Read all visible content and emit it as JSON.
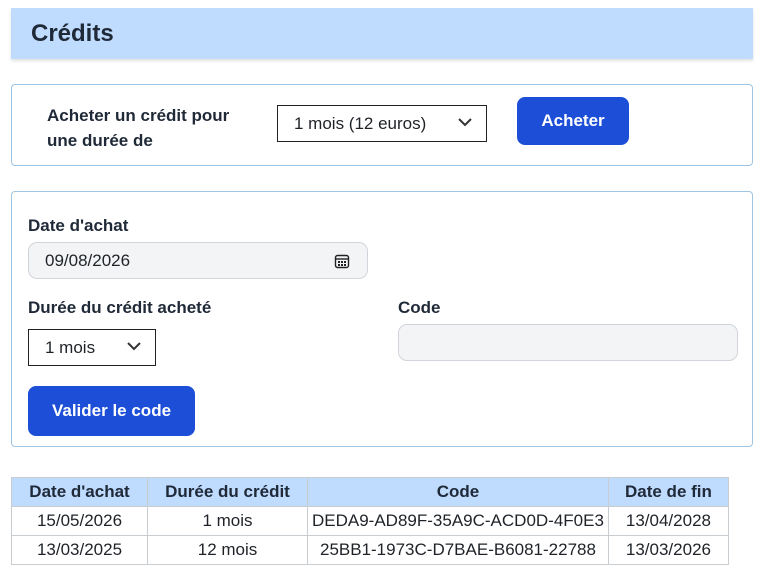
{
  "header": {
    "title": "Crédits"
  },
  "buy": {
    "label": "Acheter un crédit pour une durée de",
    "selected_option": "1 mois (12 euros)",
    "button_label": "Acheter"
  },
  "code_form": {
    "date_label": "Date d'achat",
    "date_value": "09/08/2026",
    "duration_label": "Durée du crédit acheté",
    "duration_value": "1 mois",
    "code_label": "Code",
    "code_value": "",
    "validate_label": "Valider le code"
  },
  "table": {
    "headers": [
      "Date d'achat",
      "Durée du crédit",
      "Code",
      "Date de fin"
    ],
    "rows": [
      [
        "15/05/2026",
        "1 mois",
        "DEDA9-AD89F-35A9C-ACD0D-4F0E3",
        "13/04/2028"
      ],
      [
        "13/03/2025",
        "12 mois",
        "25BB1-1973C-D7BAE-B6081-22788",
        "13/03/2026"
      ]
    ]
  },
  "colors": {
    "accent": "#1d4ed8",
    "header_bg": "#bfdbfe",
    "panel_border": "#9ec5e4"
  },
  "icons": {
    "select": "chevron-down-icon",
    "date": "calendar-icon"
  }
}
